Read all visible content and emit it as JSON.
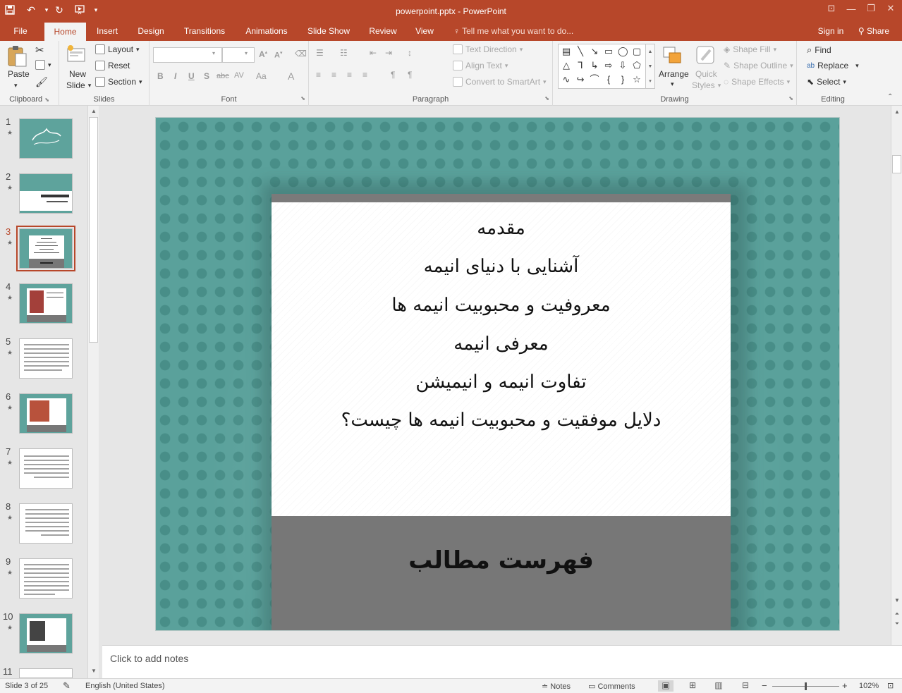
{
  "window": {
    "title": "powerpoint.pptx - PowerPoint",
    "quick_access": [
      "save-icon",
      "undo-icon",
      "redo-icon",
      "start-from-beginning-icon",
      "customize-icon"
    ]
  },
  "tabs": [
    "File",
    "Home",
    "Insert",
    "Design",
    "Transitions",
    "Animations",
    "Slide Show",
    "Review",
    "View"
  ],
  "active_tab": "Home",
  "tell_me": "Tell me what you want to do...",
  "account": {
    "sign_in": "Sign in",
    "share": "Share"
  },
  "ribbon": {
    "clipboard": {
      "label": "Clipboard",
      "paste": "Paste"
    },
    "slides": {
      "label": "Slides",
      "new_slide_line1": "New",
      "new_slide_line2": "Slide",
      "layout": "Layout",
      "reset": "Reset",
      "section": "Section"
    },
    "font": {
      "label": "Font",
      "bold": "B",
      "italic": "I",
      "underline": "U",
      "shadow": "S",
      "strike": "abc",
      "spacing": "AV",
      "case": "Aa",
      "color": "A"
    },
    "paragraph": {
      "label": "Paragraph",
      "text_direction": "Text Direction",
      "align_text": "Align Text",
      "convert_smartart": "Convert to SmartArt"
    },
    "drawing": {
      "label": "Drawing",
      "arrange": "Arrange",
      "quick_styles_1": "Quick",
      "quick_styles_2": "Styles",
      "shape_fill": "Shape Fill",
      "shape_outline": "Shape Outline",
      "shape_effects": "Shape Effects"
    },
    "editing": {
      "label": "Editing",
      "find": "Find",
      "replace": "Replace",
      "select": "Select"
    }
  },
  "slides_panel": {
    "numbers": [
      "1",
      "2",
      "3",
      "4",
      "5",
      "6",
      "7",
      "8",
      "9",
      "10",
      "11"
    ],
    "active": "3",
    "star": "★"
  },
  "slide": {
    "toc_items": [
      "مقدمه",
      "آشنایی با دنیای انیمه",
      "معروفیت و محبوبیت انیمه ها",
      "معرفی انیمه",
      "تفاوت انیمه و انیمیشن",
      "دلایل موفقیت و محبوبیت انیمه ها چیست؟"
    ],
    "title": "فهرست مطالب"
  },
  "notes_placeholder": "Click to add notes",
  "status": {
    "slide_info": "Slide 3 of 25",
    "language": "English (United States)",
    "notes": "Notes",
    "comments": "Comments",
    "zoom": "102%"
  }
}
